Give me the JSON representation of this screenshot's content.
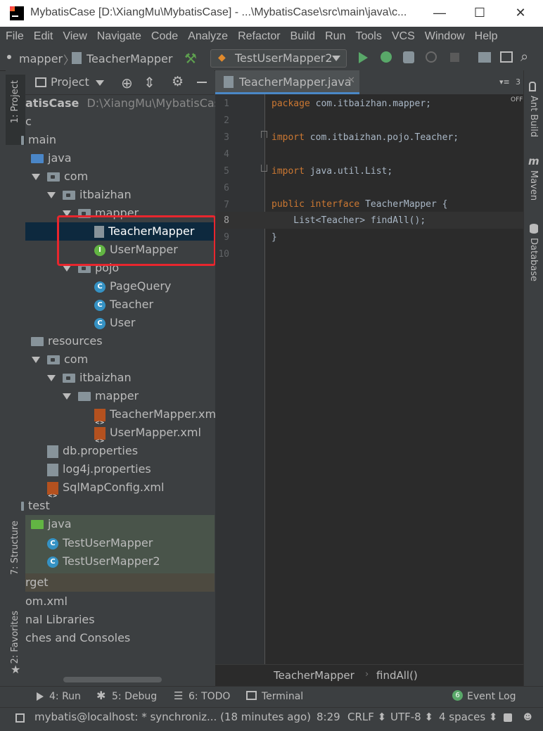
{
  "window": {
    "title": "MybatisCase [D:\\XiangMu\\MybatisCase] - ...\\MybatisCase\\src\\main\\java\\c...",
    "minimize": "—",
    "maximize": "☐",
    "close": "✕"
  },
  "menu": [
    "File",
    "Edit",
    "View",
    "Navigate",
    "Code",
    "Analyze",
    "Refactor",
    "Build",
    "Run",
    "Tools",
    "VCS",
    "Window",
    "Help"
  ],
  "nav": {
    "crumb_mapper": "mapper",
    "crumb_file": "TeacherMapper",
    "run_config": "TestUserMapper2"
  },
  "left_stripe": {
    "project": "1: Project",
    "structure": "7: Structure",
    "favorites": "2: Favorites"
  },
  "project_panel": {
    "title": "Project",
    "root_name": "atisCase",
    "root_path": "D:\\XiangMu\\MybatisCase\\M"
  },
  "tree": [
    {
      "label": "c"
    },
    {
      "label": "main"
    },
    {
      "label": "java"
    },
    {
      "label": "com"
    },
    {
      "label": "itbaizhan"
    },
    {
      "label": "mapper"
    },
    {
      "label": "TeacherMapper"
    },
    {
      "label": "UserMapper"
    },
    {
      "label": "pojo"
    },
    {
      "label": "PageQuery"
    },
    {
      "label": "Teacher"
    },
    {
      "label": "User"
    },
    {
      "label": "resources"
    },
    {
      "label": "com"
    },
    {
      "label": "itbaizhan"
    },
    {
      "label": "mapper"
    },
    {
      "label": "TeacherMapper.xml"
    },
    {
      "label": "UserMapper.xml"
    },
    {
      "label": "db.properties"
    },
    {
      "label": "log4j.properties"
    },
    {
      "label": "SqlMapConfig.xml"
    },
    {
      "label": "test"
    },
    {
      "label": "java"
    },
    {
      "label": "TestUserMapper"
    },
    {
      "label": "TestUserMapper2"
    },
    {
      "label": "rget"
    },
    {
      "label": "om.xml"
    },
    {
      "label": "nal Libraries"
    },
    {
      "label": "ches and Consoles"
    }
  ],
  "editor": {
    "tab_label": "TeacherMapper.java",
    "tab_count": "3",
    "off_label": "OFF",
    "line_numbers": [
      "1",
      "2",
      "3",
      "4",
      "5",
      "6",
      "7",
      "8",
      "9",
      "10"
    ],
    "lines": {
      "l1_kw": "package",
      "l1_rest": " com.itbaizhan.mapper;",
      "l3_kw": "import",
      "l3_rest": " com.itbaizhan.pojo.Teacher;",
      "l5_kw": "import",
      "l5_rest": " java.util.List;",
      "l7_kw1": "public",
      "l7_kw2": " interface",
      "l7_rest": " TeacherMapper {",
      "l8": "    List<Teacher> findAll();",
      "l9": "}"
    },
    "breadcrumb_class": "TeacherMapper",
    "breadcrumb_method": "findAll()"
  },
  "right_stripe": {
    "ant": "Ant Build",
    "maven": "Maven",
    "database": "Database"
  },
  "bottom_tools": {
    "run": "4: Run",
    "debug": "5: Debug",
    "todo": "6: TODO",
    "terminal": "Terminal",
    "event_count": "6",
    "event_log": "Event Log"
  },
  "status": {
    "message": "mybatis@localhost: * synchroniz... (18 minutes ago)",
    "position": "8:29",
    "line_sep": "CRLF ⬍",
    "encoding": "UTF-8 ⬍",
    "indent": "4 spaces ⬍"
  },
  "colors": {
    "keyword": "#cc7832",
    "selection": "#0d293e",
    "highlight_box": "#e8262e"
  }
}
